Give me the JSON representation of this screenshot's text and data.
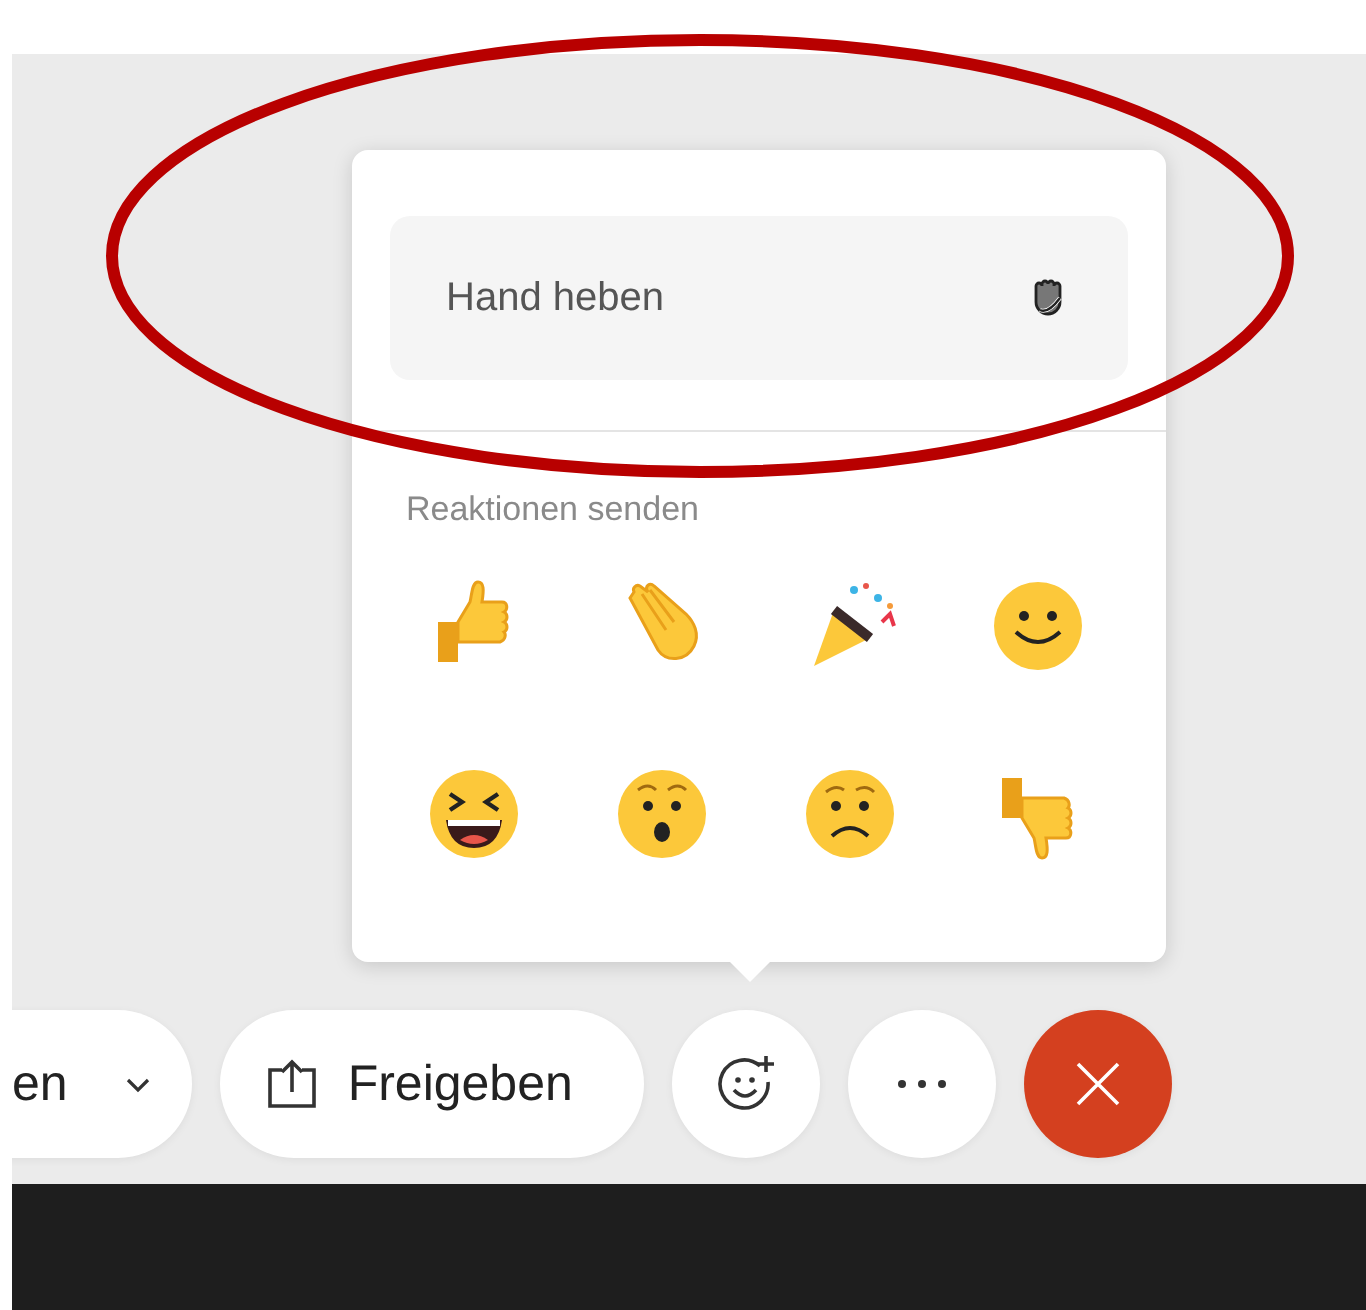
{
  "popup": {
    "raise_hand": {
      "label": "Hand heben"
    },
    "section_label": "Reaktionen senden",
    "reactions": [
      {
        "kind": "thumbs-up"
      },
      {
        "kind": "clap"
      },
      {
        "kind": "party"
      },
      {
        "kind": "smile"
      },
      {
        "kind": "laugh"
      },
      {
        "kind": "surprised"
      },
      {
        "kind": "sad"
      },
      {
        "kind": "thumbs-down"
      }
    ]
  },
  "toolbar": {
    "buttons": [
      {
        "kind": "dropdown",
        "label": "en"
      },
      {
        "kind": "share",
        "label": "Freigeben"
      },
      {
        "kind": "reactions"
      },
      {
        "kind": "more"
      },
      {
        "kind": "leave"
      }
    ]
  },
  "annotation": {
    "kind": "ellipse"
  }
}
